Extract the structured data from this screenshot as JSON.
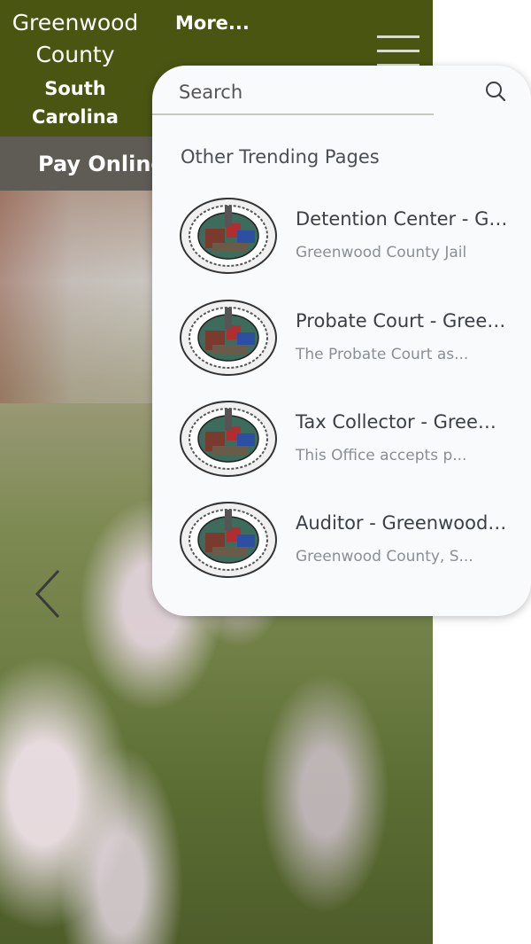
{
  "header": {
    "county_name": "Greenwood County",
    "state_name": "South Carolina",
    "more_label": "More..."
  },
  "subbar": {
    "pay_online_label": "Pay Online"
  },
  "search": {
    "placeholder": "Search",
    "trending_heading": "Other Trending Pages",
    "results": [
      {
        "title": "Detention Center - Greenwood County",
        "description": "Greenwood County Jail"
      },
      {
        "title": "Probate Court - Greenwood County",
        "description": "The Probate Court as..."
      },
      {
        "title": "Tax Collector - Greenwood County",
        "description": "This Office accepts p..."
      },
      {
        "title": "Auditor - Greenwood County",
        "description": "Greenwood County, S..."
      }
    ]
  },
  "icons": {
    "search": "search-icon",
    "menu": "hamburger-menu-icon",
    "prev": "chevron-left-icon",
    "logo": "county-seal-icon"
  },
  "colors": {
    "header_bg": "#4a5512",
    "subbar_bg": "#5f5c56",
    "panel_bg": "#f8fafb"
  }
}
